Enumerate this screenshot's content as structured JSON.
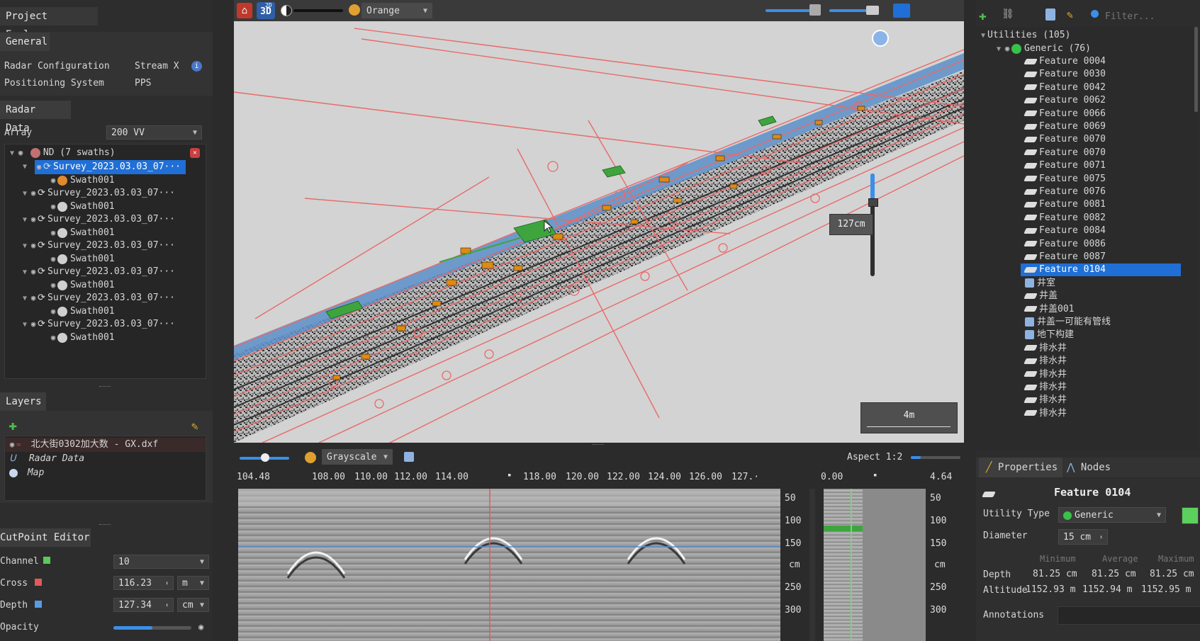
{
  "project_explorer": {
    "title": "Project Explorer",
    "general_tab": "General",
    "radar_config_label": "Radar Configuration",
    "radar_config_value": "Stream X",
    "positioning_label": "Positioning System",
    "positioning_value": "PPS"
  },
  "radar_data": {
    "tab": "Radar Data",
    "array_label": "Array",
    "array_value": "200 VV",
    "root": "ND (7 swaths)",
    "surveys": [
      {
        "name": "Survey_2023.03.03_07···",
        "swath": "Swath001"
      },
      {
        "name": "Survey_2023.03.03_07···",
        "swath": "Swath001"
      },
      {
        "name": "Survey_2023.03.03_07···",
        "swath": "Swath001"
      },
      {
        "name": "Survey_2023.03.03_07···",
        "swath": "Swath001"
      },
      {
        "name": "Survey_2023.03.03_07···",
        "swath": "Swath001"
      },
      {
        "name": "Survey_2023.03.03_07···",
        "swath": "Swath001"
      },
      {
        "name": "Survey_2023.03.03_07···",
        "swath": "Swath001"
      }
    ]
  },
  "layers": {
    "title": "Layers",
    "items": [
      "北大街0302加大数 - GX.dxf",
      "Radar Data",
      "Map"
    ]
  },
  "cutpoint": {
    "title": "CutPoint Editor",
    "channel_label": "Channel",
    "channel_value": "10",
    "cross_label": "Cross",
    "cross_value": "116.23",
    "cross_unit": "m",
    "depth_label": "Depth",
    "depth_value": "127.34",
    "depth_unit": "cm",
    "opacity_label": "Opacity",
    "opacity_level": 0.5
  },
  "toolbar": {
    "mode_label": "3D",
    "mode_sub": "2D",
    "colormap": "Orange"
  },
  "viewport": {
    "depth_readout": "127cm",
    "scale_label": "4m"
  },
  "bscan": {
    "colormap": "Grayscale",
    "aspect_label": "Aspect 1:2",
    "x_ticks": [
      "104.48",
      "108.00",
      "110.00",
      "112.00",
      "114.00",
      "118.00",
      "120.00",
      "122.00",
      "124.00",
      "126.00",
      "127.·"
    ],
    "y_ticks": [
      "50",
      "100",
      "150",
      "cm",
      "250",
      "300"
    ],
    "side_x_start": "0.00",
    "side_x_end": "4.64",
    "side_y_ticks": [
      "50",
      "100",
      "150",
      "cm",
      "250",
      "300"
    ]
  },
  "utilities": {
    "filter_placeholder": "Filter...",
    "root": "Utilities (105)",
    "group": "Generic (76)",
    "features": [
      "Feature 0004",
      "Feature 0030",
      "Feature 0042",
      "Feature 0062",
      "Feature 0066",
      "Feature 0069",
      "Feature 0070",
      "Feature 0070",
      "Feature 0071",
      "Feature 0075",
      "Feature 0076",
      "Feature 0081",
      "Feature 0082",
      "Feature 0084",
      "Feature 0086",
      "Feature 0087",
      "Feature 0104"
    ],
    "cn_items": [
      {
        "label": "井室",
        "icon": "cube"
      },
      {
        "label": "井盖",
        "icon": "pipe"
      },
      {
        "label": "井盖001",
        "icon": "pipe"
      },
      {
        "label": "井盖一可能有管线",
        "icon": "cube"
      },
      {
        "label": "地下构建",
        "icon": "cube"
      },
      {
        "label": "排水井",
        "icon": "pipe"
      },
      {
        "label": "排水井",
        "icon": "pipe"
      },
      {
        "label": "排水井",
        "icon": "pipe"
      },
      {
        "label": "排水井",
        "icon": "pipe"
      },
      {
        "label": "排水井",
        "icon": "pipe"
      },
      {
        "label": "排水井",
        "icon": "pipe"
      }
    ]
  },
  "properties": {
    "tab_properties": "Properties",
    "tab_nodes": "Nodes",
    "feature_name": "Feature 0104",
    "utility_type_label": "Utility Type",
    "utility_type_value": "Generic",
    "diameter_label": "Diameter",
    "diameter_value": "15 cm",
    "col_min": "Minimum",
    "col_avg": "Average",
    "col_max": "Maximum",
    "depth_label": "Depth",
    "depth_min": "81.25 cm",
    "depth_avg": "81.25 cm",
    "depth_max": "81.25 cm",
    "altitude_label": "Altitude",
    "alt_min": "1152.93 m",
    "alt_avg": "1152.94 m",
    "alt_max": "1152.95 m",
    "annotations_label": "Annotations"
  },
  "colors": {
    "selection": "#1f6fd6",
    "cad_lines": "#e86a6a",
    "generic_green": "#38c24a"
  }
}
